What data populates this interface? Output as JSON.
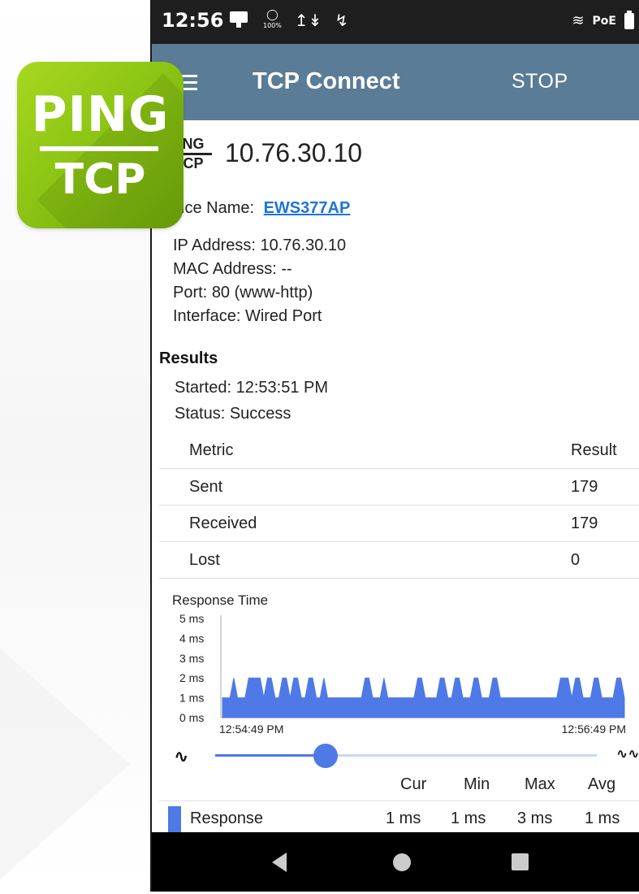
{
  "statusbar": {
    "time": "12:56",
    "icons_left": [
      "monitor-icon",
      "battery-saver-icon",
      "signal-icon",
      "bluetooth-off-icon"
    ],
    "icons_right": [
      "link-icon",
      "poe-icon",
      "battery-icon"
    ],
    "poe_label": "PoE",
    "battery_level": "100%"
  },
  "appbar": {
    "title": "TCP Connect",
    "stop_label": "STOP"
  },
  "app_icon": {
    "line1": "PING",
    "line2": "TCP"
  },
  "target": {
    "logo_top": "NG",
    "logo_bottom": "CP",
    "ip": "10.76.30.10",
    "device_name_label": "vice Name:",
    "device_name": "EWS377AP"
  },
  "info": {
    "ip_label": "IP Address:",
    "ip_value": "10.76.30.10",
    "mac_label": "MAC Address:",
    "mac_value": "--",
    "port_label": "Port:",
    "port_value": "80 (www-http)",
    "interface_label": "Interface:",
    "interface_value": "Wired Port"
  },
  "results": {
    "heading": "Results",
    "started_label": "Started:",
    "started_value": "12:53:51 PM",
    "status_label": "Status:",
    "status_value": "Success",
    "table": {
      "header_metric": "Metric",
      "header_result": "Result",
      "rows": [
        {
          "metric": "Sent",
          "result": "179"
        },
        {
          "metric": "Received",
          "result": "179"
        },
        {
          "metric": "Lost",
          "result": "0"
        }
      ]
    }
  },
  "chart_data": {
    "type": "area",
    "title": "Response Time",
    "y_ticks": [
      "5 ms",
      "4 ms",
      "3 ms",
      "2 ms",
      "1 ms",
      "0 ms"
    ],
    "ylim": [
      0,
      5
    ],
    "x_labels": [
      "12:54:49 PM",
      "12:56:49 PM"
    ],
    "series": [
      {
        "name": "Response",
        "color": "#4e79e6",
        "values": [
          1,
          1,
          1,
          2,
          1,
          1,
          1,
          2,
          2,
          2,
          2,
          1,
          2,
          2,
          1,
          1,
          2,
          2,
          1,
          2,
          2,
          1,
          1,
          2,
          2,
          1,
          1,
          2,
          1,
          1,
          1,
          1,
          1,
          1,
          1,
          1,
          1,
          1,
          2,
          2,
          1,
          1,
          1,
          2,
          1,
          1,
          1,
          1,
          1,
          1,
          1,
          1,
          2,
          2,
          1,
          1,
          1,
          1,
          2,
          2,
          1,
          1,
          2,
          2,
          1,
          1,
          1,
          2,
          2,
          1,
          1,
          1,
          2,
          2,
          1,
          1,
          1,
          1,
          1,
          1,
          1,
          1,
          1,
          1,
          1,
          1,
          1,
          1,
          1,
          1,
          2,
          2,
          2,
          1,
          2,
          2,
          1,
          1,
          1,
          2,
          2,
          1,
          1,
          1,
          1,
          2,
          2,
          1
        ]
      }
    ],
    "legend": "bottom"
  },
  "zoom": {
    "zoom_in_icon": "zoom-in-waveform-icon",
    "zoom_out_icon": "zoom-out-waveform-icon",
    "position": 0.29
  },
  "stats": {
    "headers": [
      "Cur",
      "Min",
      "Max",
      "Avg"
    ],
    "row_label": "Response",
    "values": [
      "1 ms",
      "1 ms",
      "3 ms",
      "1 ms"
    ]
  },
  "navbar": {
    "icons": [
      "back-icon",
      "home-icon",
      "recent-apps-icon"
    ]
  }
}
